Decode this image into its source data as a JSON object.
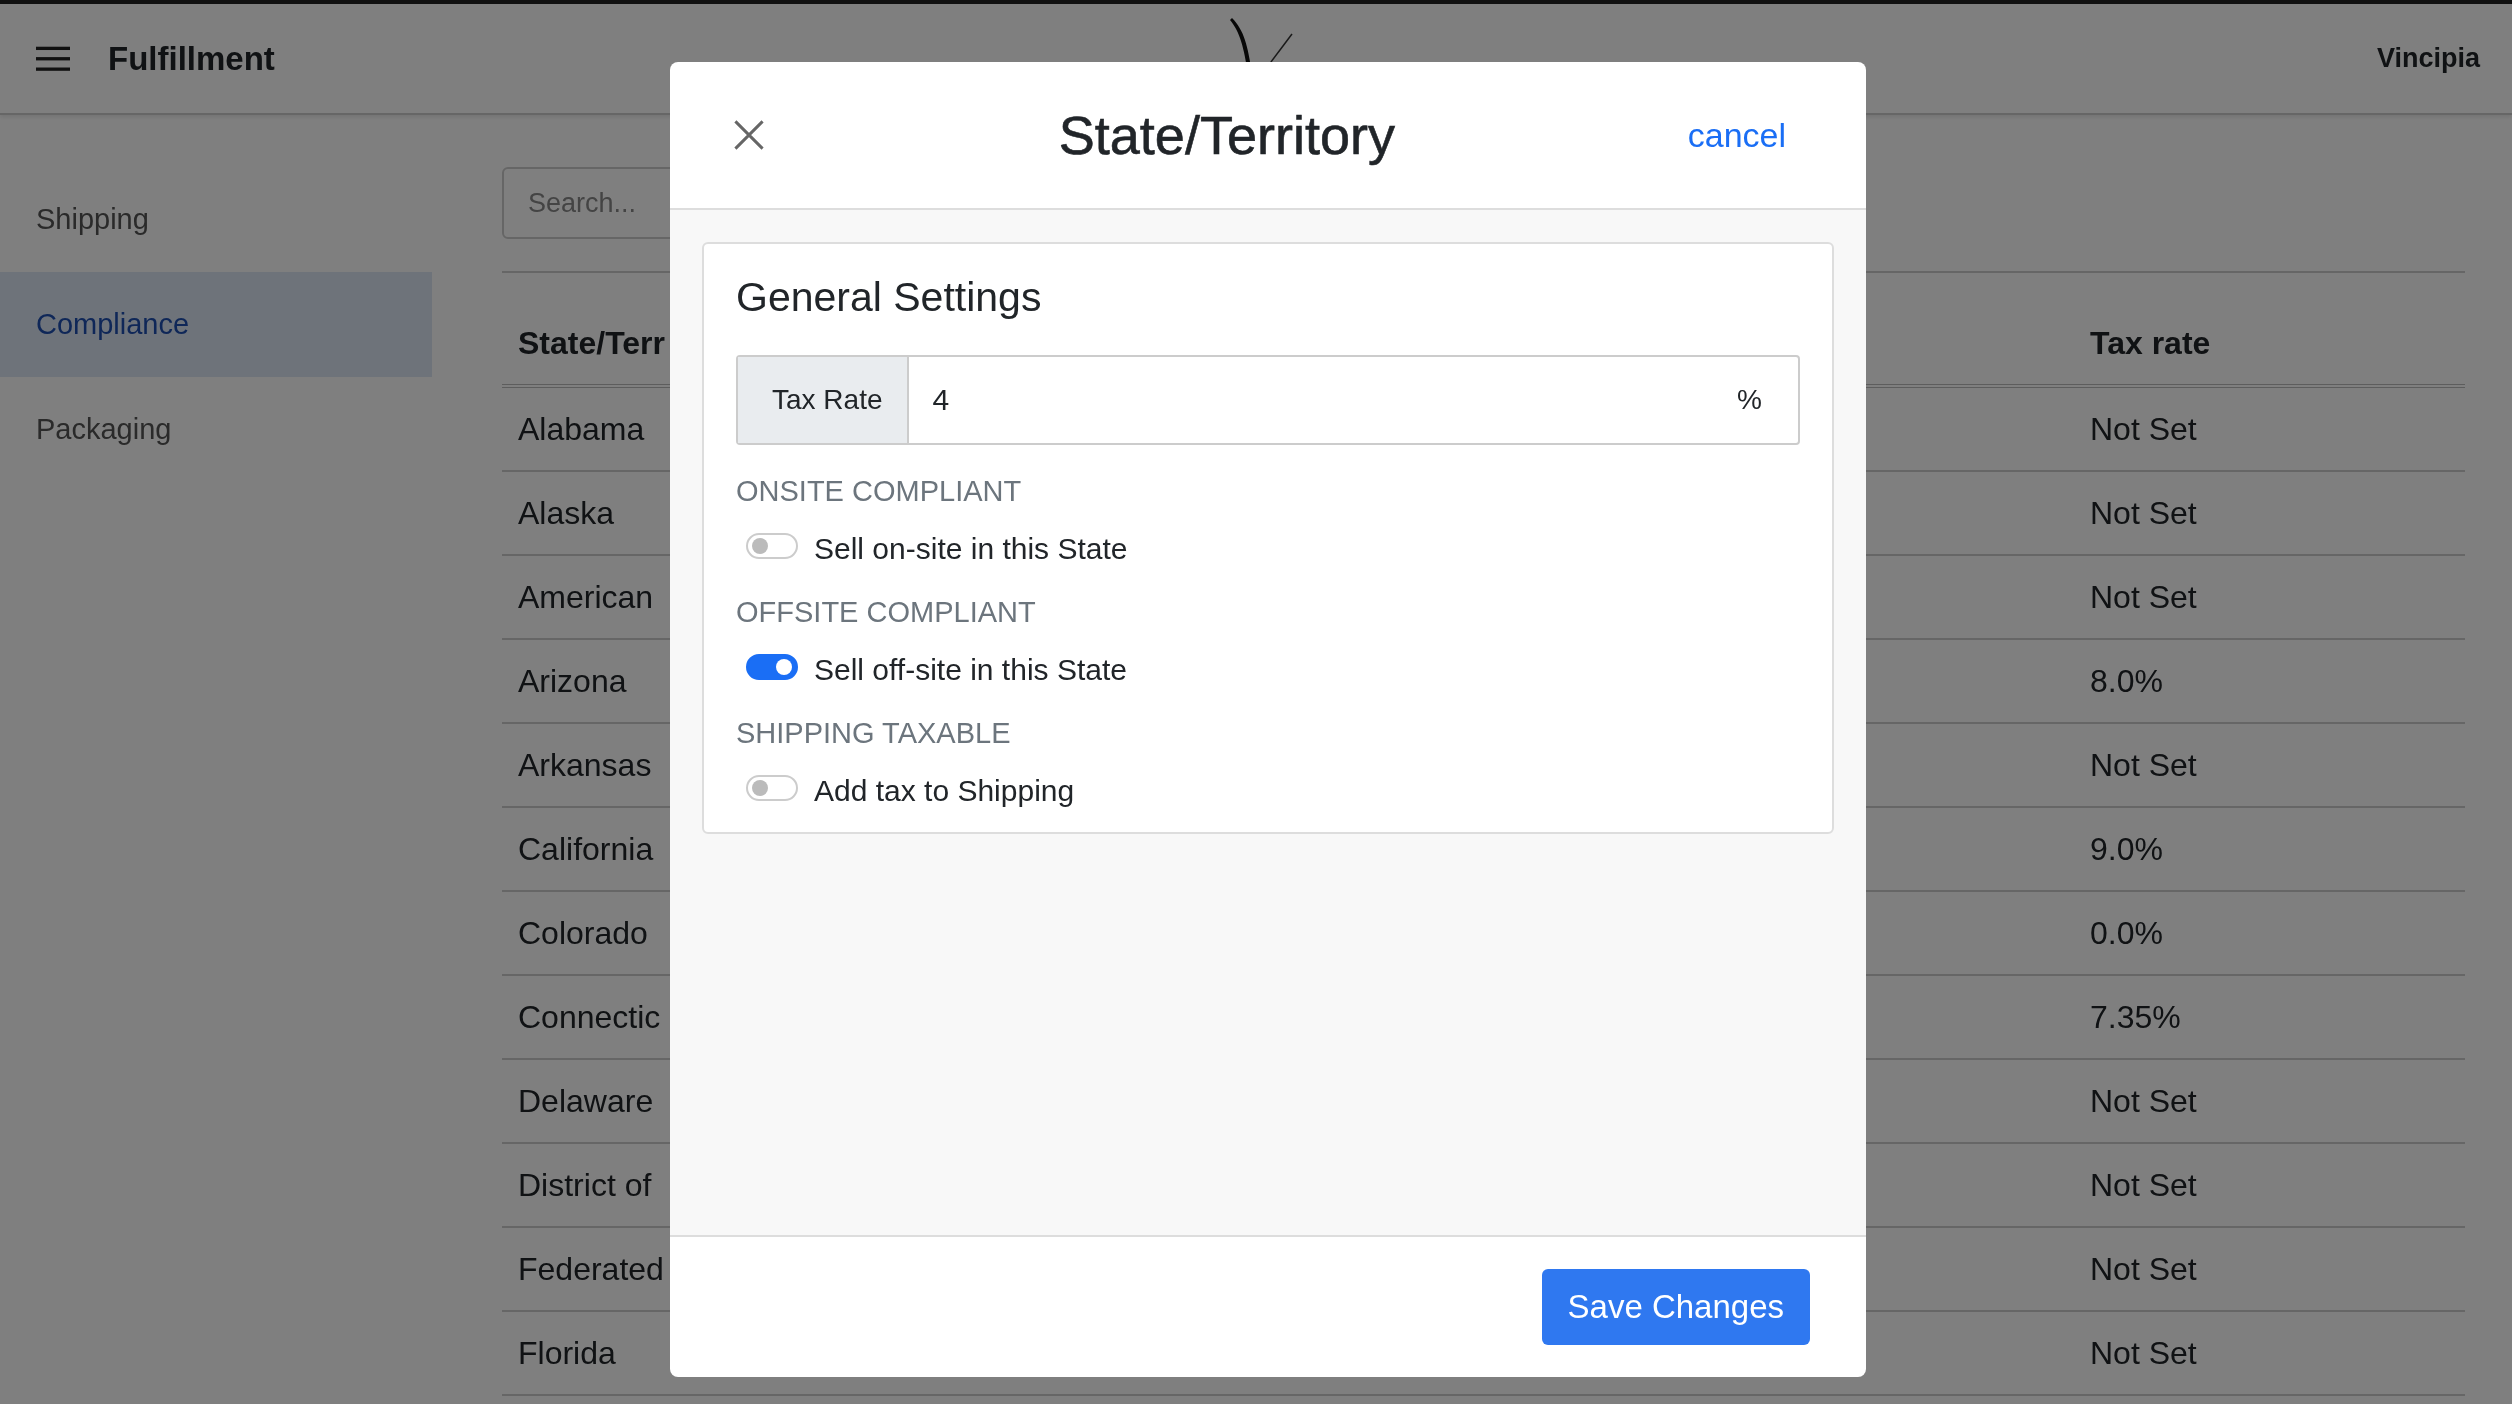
{
  "topbar": {
    "title": "Fulfillment",
    "account": "Vincipia"
  },
  "sidebar": {
    "items": [
      {
        "label": "Shipping",
        "selected": false
      },
      {
        "label": "Compliance",
        "selected": true
      },
      {
        "label": "Packaging",
        "selected": false
      }
    ]
  },
  "search": {
    "placeholder": "Search..."
  },
  "table": {
    "columns": [
      "State/Terr",
      "Tax rate"
    ],
    "rows": [
      {
        "name": "Alabama",
        "tax_rate": "Not Set"
      },
      {
        "name": "Alaska",
        "tax_rate": "Not Set"
      },
      {
        "name": "American",
        "tax_rate": "Not Set"
      },
      {
        "name": "Arizona",
        "tax_rate": "8.0%"
      },
      {
        "name": "Arkansas",
        "tax_rate": "Not Set"
      },
      {
        "name": "California",
        "tax_rate": "9.0%"
      },
      {
        "name": "Colorado",
        "tax_rate": "0.0%"
      },
      {
        "name": "Connectic",
        "tax_rate": "7.35%"
      },
      {
        "name": "Delaware",
        "tax_rate": "Not Set"
      },
      {
        "name": "District of",
        "tax_rate": "Not Set"
      },
      {
        "name": "Federated",
        "tax_rate": "Not Set"
      },
      {
        "name": "Florida",
        "tax_rate": "Not Set"
      }
    ]
  },
  "modal": {
    "title": "State/Territory",
    "cancel": "cancel",
    "section_title": "General Settings",
    "tax_rate": {
      "label": "Tax Rate",
      "value": "4",
      "suffix": "%"
    },
    "settings": [
      {
        "heading": "ONSITE COMPLIANT",
        "label": "Sell on-site in this State",
        "on": false
      },
      {
        "heading": "OFFSITE COMPLIANT",
        "label": "Sell off-site in this State",
        "on": true
      },
      {
        "heading": "SHIPPING TAXABLE",
        "label": "Add tax to Shipping",
        "on": false
      }
    ],
    "save_button": "Save Changes"
  }
}
